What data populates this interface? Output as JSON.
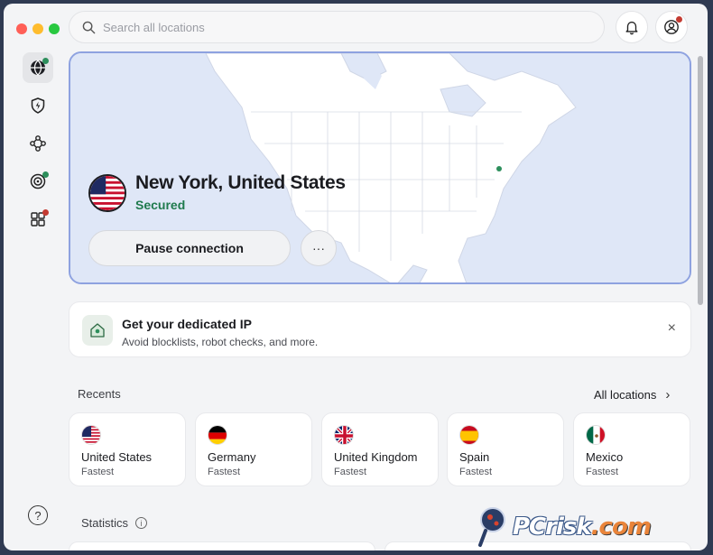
{
  "search": {
    "placeholder": "Search all locations"
  },
  "sidebar": {
    "items": [
      {
        "name": "globe-icon",
        "active": true,
        "badge": "green"
      },
      {
        "name": "shield-bolt-icon",
        "active": false
      },
      {
        "name": "mesh-network-icon",
        "active": false
      },
      {
        "name": "target-icon",
        "active": false,
        "badge": "green"
      },
      {
        "name": "apps-grid-icon",
        "active": false,
        "badge": "red"
      }
    ],
    "help_label": "?"
  },
  "connection": {
    "location": "New York, United States",
    "status": "Secured",
    "pause_label": "Pause connection",
    "more_label": "···"
  },
  "promo": {
    "title": "Get your dedicated IP",
    "subtitle": "Avoid blocklists, robot checks, and more.",
    "close": "×"
  },
  "recents": {
    "label": "Recents",
    "all_label": "All locations",
    "items": [
      {
        "name": "United States",
        "sub": "Fastest",
        "flag": "us"
      },
      {
        "name": "Germany",
        "sub": "Fastest",
        "flag": "de"
      },
      {
        "name": "United Kingdom",
        "sub": "Fastest",
        "flag": "gb"
      },
      {
        "name": "Spain",
        "sub": "Fastest",
        "flag": "es"
      },
      {
        "name": "Mexico",
        "sub": "Fastest",
        "flag": "mx"
      }
    ]
  },
  "statistics": {
    "label": "Statistics",
    "info": "i"
  },
  "watermark": {
    "pc": "PC",
    "risk": "risk",
    "dom": ".com"
  },
  "colors": {
    "accent_border": "#8ea2e0",
    "secured": "#1f7a4d",
    "map_bg": "#dfe7f7"
  }
}
